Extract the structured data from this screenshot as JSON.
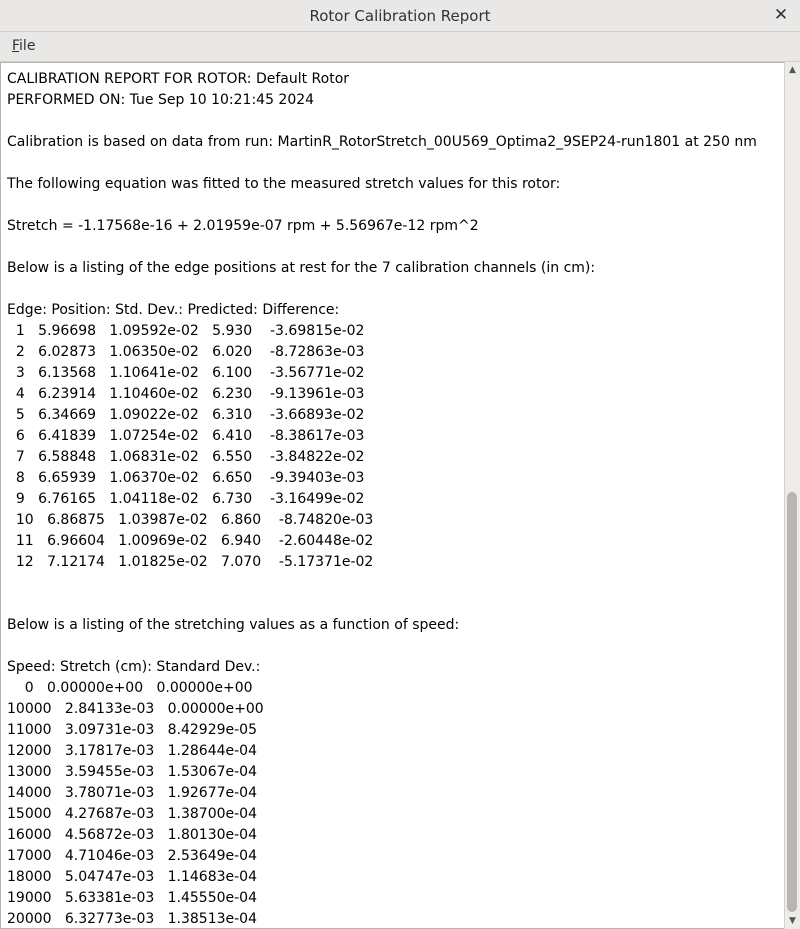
{
  "window": {
    "title": "Rotor Calibration Report",
    "close_glyph": "✕"
  },
  "menubar": {
    "file_mnemonic": "F",
    "file_rest": "ile"
  },
  "report": {
    "lines": [
      "CALIBRATION REPORT FOR ROTOR: Default Rotor",
      "PERFORMED ON: Tue Sep 10 10:21:45 2024",
      "",
      "Calibration is based on data from run: MartinR_RotorStretch_00U569_Optima2_9SEP24-run1801 at 250 nm",
      "",
      "The following equation was fitted to the measured stretch values for this rotor:",
      "",
      "Stretch = -1.17568e-16 + 2.01959e-07 rpm + 5.56967e-12 rpm^2",
      "",
      "Below is a listing of the edge positions at rest for the 7 calibration channels (in cm):",
      "",
      "Edge: Position: Std. Dev.: Predicted: Difference:",
      "  1   5.96698   1.09592e-02   5.930    -3.69815e-02",
      "  2   6.02873   1.06350e-02   6.020    -8.72863e-03",
      "  3   6.13568   1.10641e-02   6.100    -3.56771e-02",
      "  4   6.23914   1.10460e-02   6.230    -9.13961e-03",
      "  5   6.34669   1.09022e-02   6.310    -3.66893e-02",
      "  6   6.41839   1.07254e-02   6.410    -8.38617e-03",
      "  7   6.58848   1.06831e-02   6.550    -3.84822e-02",
      "  8   6.65939   1.06370e-02   6.650    -9.39403e-03",
      "  9   6.76165   1.04118e-02   6.730    -3.16499e-02",
      "  10   6.86875   1.03987e-02   6.860    -8.74820e-03",
      "  11   6.96604   1.00969e-02   6.940    -2.60448e-02",
      "  12   7.12174   1.01825e-02   7.070    -5.17371e-02",
      "",
      "",
      "Below is a listing of the stretching values as a function of speed:",
      "",
      "Speed: Stretch (cm): Standard Dev.:",
      "    0   0.00000e+00   0.00000e+00",
      "10000   2.84133e-03   0.00000e+00",
      "11000   3.09731e-03   8.42929e-05",
      "12000   3.17817e-03   1.28644e-04",
      "13000   3.59455e-03   1.53067e-04",
      "14000   3.78071e-03   1.92677e-04",
      "15000   4.27687e-03   1.38700e-04",
      "16000   4.56872e-03   1.80130e-04",
      "17000   4.71046e-03   2.53649e-04",
      "18000   5.04747e-03   1.14683e-04",
      "19000   5.63381e-03   1.45550e-04",
      "20000   6.32773e-03   1.38513e-04"
    ]
  },
  "scrollbar": {
    "up_glyph": "▲",
    "down_glyph": "▼"
  }
}
